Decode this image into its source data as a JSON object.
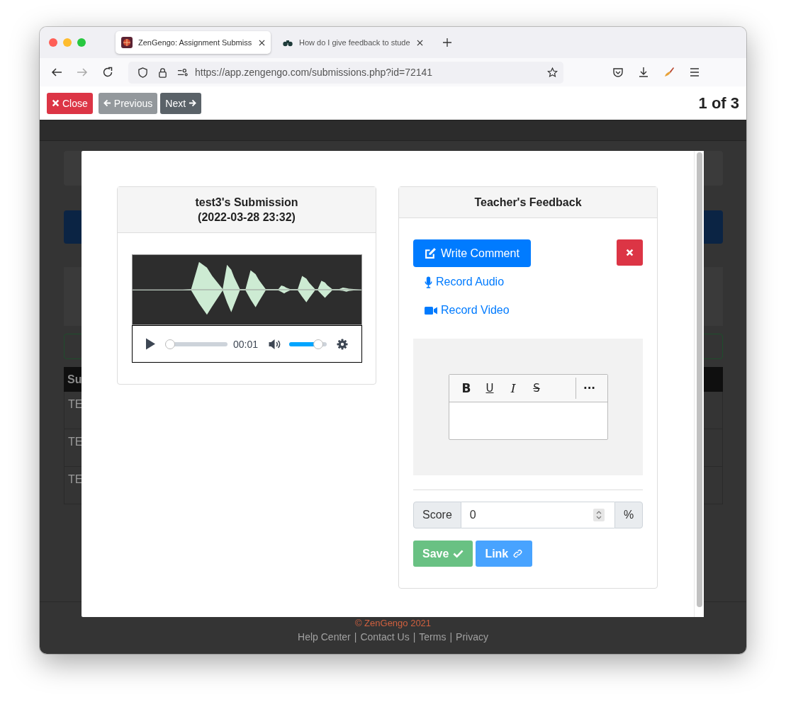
{
  "browser": {
    "tabs": [
      {
        "title": "ZenGengo: Assignment Submiss",
        "selected": true
      },
      {
        "title": "How do I give feedback to stude",
        "selected": false
      }
    ],
    "url": "https://app.zengengo.com/submissions.php?id=72141"
  },
  "toolbar": {
    "buttons": [
      {
        "label": "Close",
        "kind": "close",
        "disabled": false
      },
      {
        "label": "Previous",
        "kind": "previous",
        "disabled": true
      },
      {
        "label": "Next",
        "kind": "next",
        "disabled": false
      }
    ],
    "counter": "1 of 3"
  },
  "background": {
    "table_header": "Su",
    "rows": [
      "TE",
      "TE",
      "TE"
    ],
    "copyright": "© ZenGengo 2021",
    "separator": "|",
    "footer_links": [
      "Help Center",
      "Contact Us",
      "Terms",
      "Privacy"
    ]
  },
  "submission": {
    "title": "test3's Submission",
    "date": "(2022-03-28 23:32)",
    "player": {
      "time": "00:01",
      "progress": {
        "level": 0
      },
      "volume": {
        "level": 0.88
      }
    }
  },
  "feedback": {
    "title": "Teacher's Feedback",
    "write_comment": "Write Comment",
    "options": [
      {
        "label": "Record Audio",
        "kind": "audio"
      },
      {
        "label": "Record Video",
        "kind": "video"
      }
    ],
    "editor": {
      "tools": [
        {
          "label": "B",
          "kind": "bold"
        },
        {
          "label": "U",
          "kind": "underline"
        },
        {
          "label": "I",
          "kind": "italic"
        },
        {
          "label": "S",
          "kind": "strike"
        }
      ],
      "more": "···"
    },
    "score": {
      "label": "Score",
      "value": "0",
      "unit": "%"
    },
    "save": "Save",
    "link": "Link"
  }
}
